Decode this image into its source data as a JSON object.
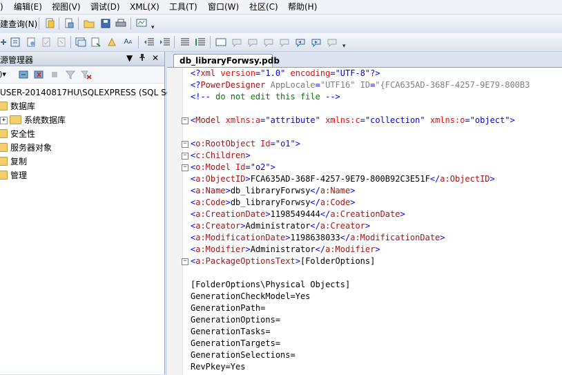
{
  "menu": {
    "items": [
      "编辑(E)",
      "视图(V)",
      "调试(D)",
      "XML(X)",
      "工具(T)",
      "窗口(W)",
      "社区(C)",
      "帮助(H)"
    ],
    "left_fragment": ")"
  },
  "toolbar": {
    "new_query_label": "建查询(N)"
  },
  "explorer": {
    "title": "源管理器",
    "pin_glyph": "▼ 📌 ✕",
    "server": "USER-20140817HU\\SQLEXPRESS (SQL Se",
    "nodes": [
      "数据库",
      "系统数据库",
      "安全性",
      "服务器对象",
      "复制",
      "管理"
    ],
    "expander": "+"
  },
  "document": {
    "tab_label": "db_libraryForwsy.pdb",
    "lines": [
      {
        "t": "<?xml version=\"1.0\" encoding=\"UTF-8\"?>",
        "kind": "pi"
      },
      {
        "t": "<?PowerDesigner AppLocale=\"UTF16\" ID=\"{FCA635AD-368F-4257-9E79-800B3",
        "kind": "pi2"
      },
      {
        "t": "<!-- do not edit this file -->",
        "kind": "comment"
      },
      {
        "t": "",
        "kind": "text"
      },
      {
        "t": "<Model xmlns:a=\"attribute\" xmlns:c=\"collection\" xmlns:o=\"object\">",
        "kind": "model"
      },
      {
        "t": "",
        "kind": "text"
      },
      {
        "t": "<o:RootObject Id=\"o1\">",
        "kind": "tagattr"
      },
      {
        "t": "<c:Children>",
        "kind": "tag"
      },
      {
        "t": "<o:Model Id=\"o2\">",
        "kind": "tagattr"
      },
      {
        "t": "<a:ObjectID>FCA635AD-368F-4257-9E79-800B92C3E51F</a:ObjectID>",
        "kind": "elem"
      },
      {
        "t": "<a:Name>db_libraryForwsy</a:Name>",
        "kind": "elem"
      },
      {
        "t": "<a:Code>db_libraryForwsy</a:Code>",
        "kind": "elem"
      },
      {
        "t": "<a:CreationDate>1198549444</a:CreationDate>",
        "kind": "elem"
      },
      {
        "t": "<a:Creator>Administrator</a:Creator>",
        "kind": "elem"
      },
      {
        "t": "<a:ModificationDate>1198638033</a:ModificationDate>",
        "kind": "elem"
      },
      {
        "t": "<a:Modifier>Administrator</a:Modifier>",
        "kind": "elem"
      },
      {
        "t": "<a:PackageOptionsText>[FolderOptions]",
        "kind": "elem"
      },
      {
        "t": "",
        "kind": "text"
      },
      {
        "t": "[FolderOptions\\Physical Objects]",
        "kind": "text"
      },
      {
        "t": "GenerationCheckModel=Yes",
        "kind": "text"
      },
      {
        "t": "GenerationPath=",
        "kind": "text"
      },
      {
        "t": "GenerationOptions=",
        "kind": "text"
      },
      {
        "t": "GenerationTasks=",
        "kind": "text"
      },
      {
        "t": "GenerationTargets=",
        "kind": "text"
      },
      {
        "t": "GenerationSelections=",
        "kind": "text"
      },
      {
        "t": "RevPkey=Yes",
        "kind": "text"
      }
    ],
    "fold_glyph": "−"
  },
  "colors": {
    "tag": "#a31515",
    "attr": "#ff0000",
    "value": "#0000ff",
    "comment": "#008000"
  }
}
